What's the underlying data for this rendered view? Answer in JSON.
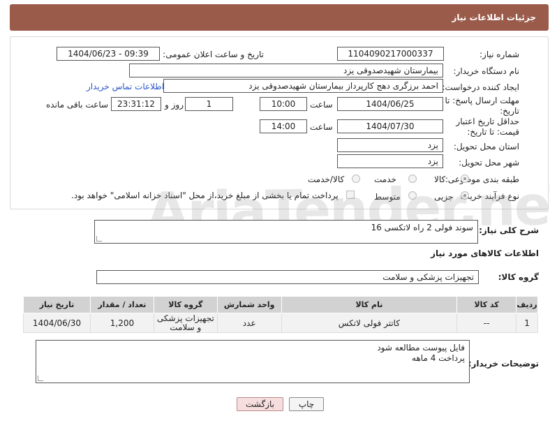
{
  "header": {
    "title": "جزئیات اطلاعات نیاز"
  },
  "form": {
    "need_number_label": "شماره نیاز:",
    "need_number": "1104090217000337",
    "announce_label": "تاریخ و ساعت اعلان عمومی:",
    "announce_value": "1404/06/23 - 09:39",
    "buyer_org_label": "نام دستگاه خریدار:",
    "buyer_org": "بیمارستان شهیدصدوقی یزد",
    "creator_label": "ایجاد کننده درخواست:",
    "creator": "احمد برزگری دهج کارپرداز بیمارستان شهیدصدوقی یزد",
    "buyer_contact_link": "اطلاعات تماس خریدار",
    "reply_deadline_label": "مهلت ارسال پاسخ: تا تاریخ:",
    "reply_date": "1404/06/25",
    "time_label": "ساعت",
    "reply_time": "10:00",
    "days_value": "1",
    "days_label": "روز و",
    "remaining_time": "23:31:12",
    "remaining_label": "ساعت باقی مانده",
    "price_validity_label": "حداقل تاریخ اعتبار قیمت: تا تاریخ:",
    "price_date": "1404/07/30",
    "price_time": "14:00",
    "province_label": "استان محل تحویل:",
    "province": "یزد",
    "city_label": "شهر محل تحویل:",
    "city": "یزد",
    "category_label": "طبقه بندی موضوعی:",
    "category_options": [
      "کالا",
      "خدمت",
      "کالا/خدمت"
    ],
    "process_label": "نوع فرآیند خرید :",
    "process_options": [
      "جزیی",
      "متوسط"
    ],
    "payment_note": "پرداخت تمام یا بخشی از مبلغ خرید،از محل \"اسناد خزانه اسلامی\" خواهد بود."
  },
  "description": {
    "label": "شرح کلی نیاز:",
    "value": "سوند فولی 2 راه لاتکسی 16"
  },
  "goods": {
    "section_title": "اطلاعات کالاهای مورد نیاز",
    "group_label": "گروه کالا:",
    "group_value": "تجهیزات پزشکی و سلامت",
    "table": {
      "headers": [
        "ردیف",
        "کد کالا",
        "نام کالا",
        "واحد شمارش",
        "گروه کالا",
        "تعداد / مقدار",
        "تاریخ نیاز"
      ],
      "rows": [
        [
          "1",
          "--",
          "کاتتر فولی لاتکس",
          "عدد",
          "تجهیزات پزشکی و سلامت",
          "1,200",
          "1404/06/30"
        ]
      ]
    }
  },
  "buyer_notes": {
    "label": "توضیحات خریدار:",
    "line1": "فایل پیوست مطالعه شود",
    "line2": "پرداخت 4 ماهه"
  },
  "buttons": {
    "print": "چاپ",
    "back": "بازگشت"
  },
  "watermark": "AriaTender.neT"
}
